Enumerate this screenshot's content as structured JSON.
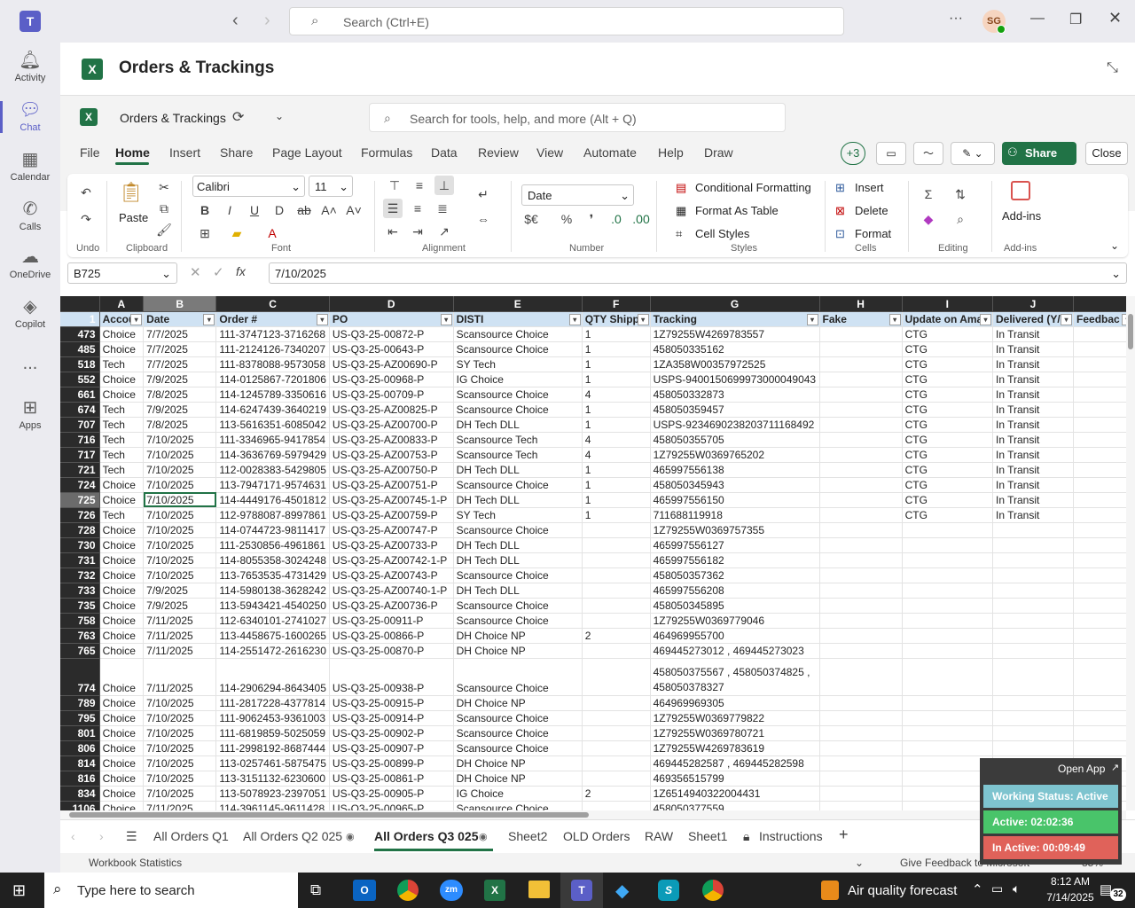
{
  "teams": {
    "search_placeholder": "Search (Ctrl+E)",
    "avatar": "SG",
    "rail": [
      {
        "label": "Activity",
        "icon": "bell-icon"
      },
      {
        "label": "Chat",
        "icon": "chat-icon"
      },
      {
        "label": "Calendar",
        "icon": "calendar-icon"
      },
      {
        "label": "Calls",
        "icon": "phone-icon"
      },
      {
        "label": "OneDrive",
        "icon": "cloud-icon"
      },
      {
        "label": "Copilot",
        "icon": "copilot-icon"
      },
      {
        "label": "...",
        "icon": "more-icon"
      },
      {
        "label": "Apps",
        "icon": "apps-icon"
      }
    ]
  },
  "app": {
    "title": "Orders & Trackings"
  },
  "excel": {
    "file_name": "Orders & Trackings",
    "search_placeholder": "Search for tools, help, and more (Alt + Q)",
    "tabs": [
      "File",
      "Home",
      "Insert",
      "Share",
      "Page Layout",
      "Formulas",
      "Data",
      "Review",
      "View",
      "Automate",
      "Help",
      "Draw"
    ],
    "active_tab": "Home",
    "collab_count": "+3",
    "share_label": "Share",
    "close_label": "Close",
    "ribbon": {
      "undo_group": "Undo",
      "paste": "Paste",
      "clipboard_group": "Clipboard",
      "font_name": "Calibri",
      "font_size": "11",
      "font_group": "Font",
      "alignment_group": "Alignment",
      "number_format": "Date",
      "number_group": "Number",
      "conditional": "Conditional Formatting",
      "format_table": "Format As Table",
      "cell_styles": "Cell Styles",
      "styles_group": "Styles",
      "insert": "Insert",
      "delete": "Delete",
      "format": "Format",
      "cells_group": "Cells",
      "editing_group": "Editing",
      "addins": "Add-ins",
      "addins_group": "Add-ins"
    },
    "name_box": "B725",
    "formula_value": "7/10/2025"
  },
  "grid": {
    "columns": [
      "A",
      "B",
      "C",
      "D",
      "E",
      "F",
      "G",
      "H",
      "I",
      "J"
    ],
    "headers": [
      "Accou",
      "Date",
      "Order #",
      "PO",
      "DISTI",
      "QTY Shippe",
      "Tracking",
      "Fake",
      "Update on Ama",
      "Delivered (Y/",
      "Feedbac"
    ],
    "rows": [
      [
        "473",
        "Choice",
        "7/7/2025",
        "111-3747123-3716268",
        "US-Q3-25-00872-P",
        "Scansource Choice",
        "1",
        "1Z79255W4269783557",
        "",
        "CTG",
        "In Transit"
      ],
      [
        "485",
        "Choice",
        "7/7/2025",
        "111-2124126-7340207",
        "US-Q3-25-00643-P",
        "Scansource Choice",
        "1",
        "458050335162",
        "",
        "CTG",
        "In Transit"
      ],
      [
        "518",
        "Tech",
        "7/7/2025",
        "111-8378088-9573058",
        "US-Q3-25-AZ00690-P",
        "SY Tech",
        "1",
        "1ZA358W00357972525",
        "",
        "CTG",
        "In Transit"
      ],
      [
        "552",
        "Choice",
        "7/9/2025",
        "114-0125867-7201806",
        "US-Q3-25-00968-P",
        "IG Choice",
        "1",
        "USPS-9400150699973000049043",
        "",
        "CTG",
        "In Transit"
      ],
      [
        "661",
        "Choice",
        "7/8/2025",
        "114-1245789-3350616",
        "US-Q3-25-00709-P",
        "Scansource Choice",
        "4",
        "458050332873",
        "",
        "CTG",
        "In Transit"
      ],
      [
        "674",
        "Tech",
        "7/9/2025",
        "114-6247439-3640219",
        "US-Q3-25-AZ00825-P",
        "Scansource Choice",
        "1",
        "458050359457",
        "",
        "CTG",
        "In Transit"
      ],
      [
        "707",
        "Tech",
        "7/8/2025",
        "113-5616351-6085042",
        "US-Q3-25-AZ00700-P",
        "DH Tech DLL",
        "1",
        "USPS-9234690238203711168492",
        "",
        "CTG",
        "In Transit"
      ],
      [
        "716",
        "Tech",
        "7/10/2025",
        "111-3346965-9417854",
        "US-Q3-25-AZ00833-P",
        "Scansource Tech",
        "4",
        "458050355705",
        "",
        "CTG",
        "In Transit"
      ],
      [
        "717",
        "Tech",
        "7/10/2025",
        "114-3636769-5979429",
        "US-Q3-25-AZ00753-P",
        "Scansource Tech",
        "4",
        "1Z79255W0369765202",
        "",
        "CTG",
        "In Transit"
      ],
      [
        "721",
        "Tech",
        "7/10/2025",
        "112-0028383-5429805",
        "US-Q3-25-AZ00750-P",
        "DH Tech DLL",
        "1",
        "465997556138",
        "",
        "CTG",
        "In Transit"
      ],
      [
        "724",
        "Choice",
        "7/10/2025",
        "113-7947171-9574631",
        "US-Q3-25-AZ00751-P",
        "Scansource Choice",
        "1",
        "458050345943",
        "",
        "CTG",
        "In Transit"
      ],
      [
        "725",
        "Choice",
        "7/10/2025",
        "114-4449176-4501812",
        "US-Q3-25-AZ00745-1-P",
        "DH Tech DLL",
        "1",
        "465997556150",
        "",
        "CTG",
        "In Transit"
      ],
      [
        "726",
        "Tech",
        "7/10/2025",
        "112-9788087-8997861",
        "US-Q3-25-AZ00759-P",
        "SY Tech",
        "1",
        "711688119918",
        "",
        "CTG",
        "In Transit"
      ],
      [
        "728",
        "Choice",
        "7/10/2025",
        "114-0744723-9811417",
        "US-Q3-25-AZ00747-P",
        "Scansource Choice",
        "",
        "1Z79255W0369757355",
        "",
        "",
        ""
      ],
      [
        "730",
        "Choice",
        "7/10/2025",
        "111-2530856-4961861",
        "US-Q3-25-AZ00733-P",
        "DH Tech DLL",
        "",
        "465997556127",
        "",
        "",
        ""
      ],
      [
        "731",
        "Choice",
        "7/10/2025",
        "114-8055358-3024248",
        "US-Q3-25-AZ00742-1-P",
        "DH Tech DLL",
        "",
        "465997556182",
        "",
        "",
        ""
      ],
      [
        "732",
        "Choice",
        "7/10/2025",
        "113-7653535-4731429",
        "US-Q3-25-AZ00743-P",
        "Scansource Choice",
        "",
        "458050357362",
        "",
        "",
        ""
      ],
      [
        "733",
        "Choice",
        "7/9/2025",
        "114-5980138-3628242",
        "US-Q3-25-AZ00740-1-P",
        "DH Tech DLL",
        "",
        "465997556208",
        "",
        "",
        ""
      ],
      [
        "735",
        "Choice",
        "7/9/2025",
        "113-5943421-4540250",
        "US-Q3-25-AZ00736-P",
        "Scansource Choice",
        "",
        "458050345895",
        "",
        "",
        ""
      ],
      [
        "758",
        "Choice",
        "7/11/2025",
        "112-6340101-2741027",
        "US-Q3-25-00911-P",
        "Scansource Choice",
        "",
        "1Z79255W0369779046",
        "",
        "",
        ""
      ],
      [
        "763",
        "Choice",
        "7/11/2025",
        "113-4458675-1600265",
        "US-Q3-25-00866-P",
        "DH Choice NP",
        "2",
        "464969955700",
        "",
        "",
        ""
      ],
      [
        "765",
        "Choice",
        "7/11/2025",
        "114-2551472-2616230",
        "US-Q3-25-00870-P",
        "DH Choice NP",
        "",
        "469445273012 , 469445273023",
        "",
        "",
        ""
      ],
      [
        "774",
        "Choice",
        "7/11/2025",
        "114-2906294-8643405",
        "US-Q3-25-00938-P",
        "Scansource Choice",
        "",
        "458050375567 , 458050374825 , 458050378327",
        "",
        "",
        ""
      ],
      [
        "789",
        "Choice",
        "7/10/2025",
        "111-2817228-4377814",
        "US-Q3-25-00915-P",
        "DH Choice NP",
        "",
        "464969969305",
        "",
        "",
        ""
      ],
      [
        "795",
        "Choice",
        "7/10/2025",
        "111-9062453-9361003",
        "US-Q3-25-00914-P",
        "Scansource Choice",
        "",
        "1Z79255W0369779822",
        "",
        "",
        ""
      ],
      [
        "801",
        "Choice",
        "7/10/2025",
        "111-6819859-5025059",
        "US-Q3-25-00902-P",
        "Scansource Choice",
        "",
        "1Z79255W0369780721",
        "",
        "",
        ""
      ],
      [
        "806",
        "Choice",
        "7/10/2025",
        "111-2998192-8687444",
        "US-Q3-25-00907-P",
        "Scansource Choice",
        "",
        "1Z79255W4269783619",
        "",
        "",
        ""
      ],
      [
        "814",
        "Choice",
        "7/10/2025",
        "113-0257461-5875475",
        "US-Q3-25-00899-P",
        "DH Choice NP",
        "",
        "469445282587 , 469445282598",
        "",
        "",
        ""
      ],
      [
        "816",
        "Choice",
        "7/10/2025",
        "113-3151132-6230600",
        "US-Q3-25-00861-P",
        "DH Choice NP",
        "",
        "469356515799",
        "",
        "",
        ""
      ],
      [
        "834",
        "Choice",
        "7/10/2025",
        "113-5078923-2397051",
        "US-Q3-25-00905-P",
        "IG Choice",
        "2",
        "1Z6514940322004431",
        "",
        "",
        ""
      ],
      [
        "1106",
        "Choice",
        "7/11/2025",
        "114-3961145-9611428",
        "US-Q3-25-00965-P",
        "Scansource Choice",
        "",
        "458050377559",
        "",
        "",
        ""
      ]
    ]
  },
  "sheets": [
    "All Orders Q1",
    "All Orders Q2 025",
    "All Orders Q3 025",
    "Sheet2",
    "OLD Orders",
    "RAW",
    "Sheet1",
    "Instructions"
  ],
  "active_sheet": "All Orders Q3 025",
  "status": {
    "left": "Workbook Statistics",
    "feedback": "Give Feedback to Microsoft",
    "zoom": "85%"
  },
  "overlay": {
    "open_app": "Open App",
    "working": "Working Status: Active",
    "active": "Active: 02:02:36",
    "inactive": "In Active: 00:09:49"
  },
  "taskbar": {
    "search_placeholder": "Type here to search",
    "weather": "Air quality forecast",
    "time": "8:12 AM",
    "date": "7/14/2025",
    "notif": "32"
  },
  "colors": {
    "accent": "#5b5fc7",
    "excel_green": "#217346",
    "header_fill": "#cfe2f3"
  }
}
